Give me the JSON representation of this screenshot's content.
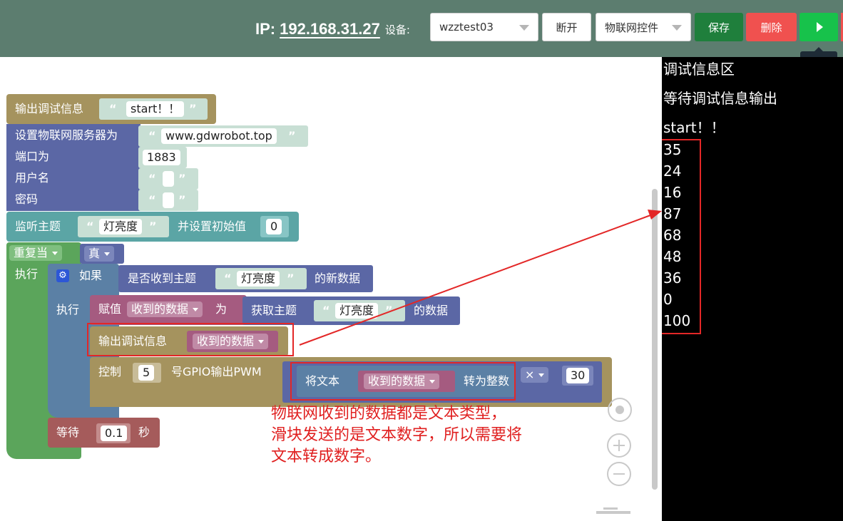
{
  "header": {
    "ip_label": "IP:",
    "ip_value": "192.168.31.27",
    "device_label": "设备:",
    "device_value": "wzztest03",
    "disconnect_label": "断开",
    "controls_value": "物联网控件",
    "save_label": "保存",
    "delete_label": "删除",
    "run_tooltip": "运行"
  },
  "debug": {
    "title": "调试信息区",
    "waiting": "等待调试信息输出",
    "lines": [
      "start！！",
      "35",
      "24",
      "16",
      "87",
      "68",
      "48",
      "36",
      "0",
      "100"
    ]
  },
  "blocks": {
    "print_label": "输出调试信息",
    "start_text": "start！！",
    "set_server_label": "设置物联网服务器为",
    "server_text": "www.gdwrobot.top",
    "port_label": "端口为",
    "port_value": "1883",
    "username_label": "用户名",
    "password_label": "密码",
    "subscribe_label": "监听主题",
    "topic_text": "灯亮度",
    "init_label": "并设置初始值",
    "init_value": "0",
    "repeat_label": "重复当",
    "true_label": "真",
    "do_label": "执行",
    "if_label": "如果",
    "received_q_label": "是否收到主题",
    "new_data_label": "的新数据",
    "do2_label": "执行",
    "assign_label": "赋值",
    "var_name": "收到的数据",
    "as_label": "为",
    "get_topic_label": "获取主题",
    "data_of_label": "的数据",
    "print2_label": "输出调试信息",
    "control_label": "控制",
    "gpio_num": "5",
    "gpio_label": "号GPIO输出PWM",
    "to_text_label": "将文本",
    "to_int_label": "转为整数",
    "mul_op": "×",
    "mul_value": "30",
    "wait_label": "等待",
    "wait_value": "0.1",
    "sec_label": "秒",
    "quote_open": "“",
    "quote_close": "”"
  },
  "annotation": "物联网收到的数据都是文本类型，\n滑块发送的是文本数字，所以需要将\n文本转成数字。",
  "colors": {
    "topbar": "#5c7d6f",
    "text_block": "#a5935e",
    "iot_block": "#5b67a5",
    "string_block": "#c8dfd4",
    "loop_block": "#5ba55b",
    "subscribe_block": "#5ba5a5",
    "variable_block": "#a55b80",
    "wait_block": "#a55b5b",
    "annotation": "#e02020"
  }
}
